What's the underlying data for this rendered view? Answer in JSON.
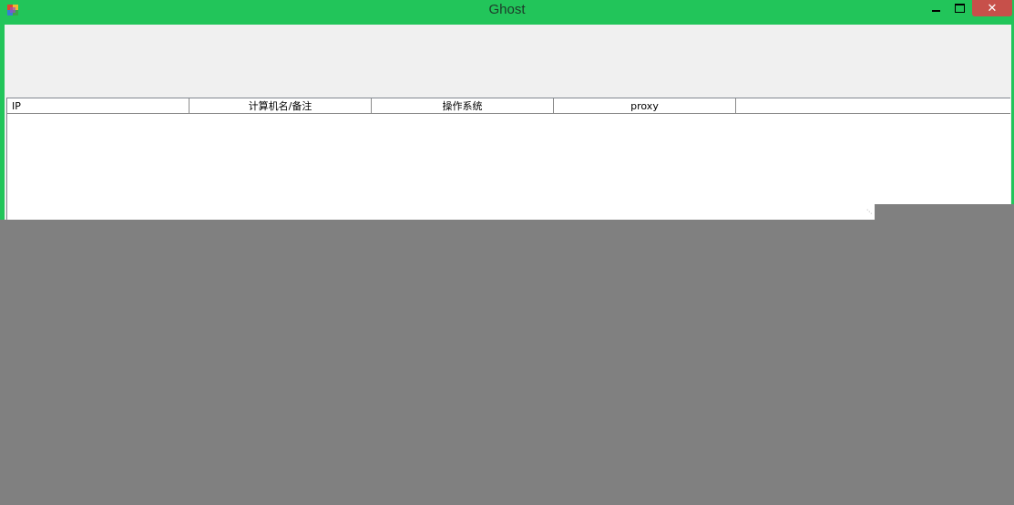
{
  "window": {
    "title": "Ghost",
    "controls": {
      "minimize": "minimize",
      "maximize": "maximize",
      "close": "✕"
    }
  },
  "colors": {
    "titlebar": "#22c55a",
    "close_button": "#c7504a",
    "client_background": "#f0f0f0",
    "desktop": "#808080"
  },
  "listview": {
    "columns": [
      {
        "label": "IP"
      },
      {
        "label": "计算机名/备注"
      },
      {
        "label": "操作系统"
      },
      {
        "label": "proxy"
      }
    ],
    "rows": []
  }
}
